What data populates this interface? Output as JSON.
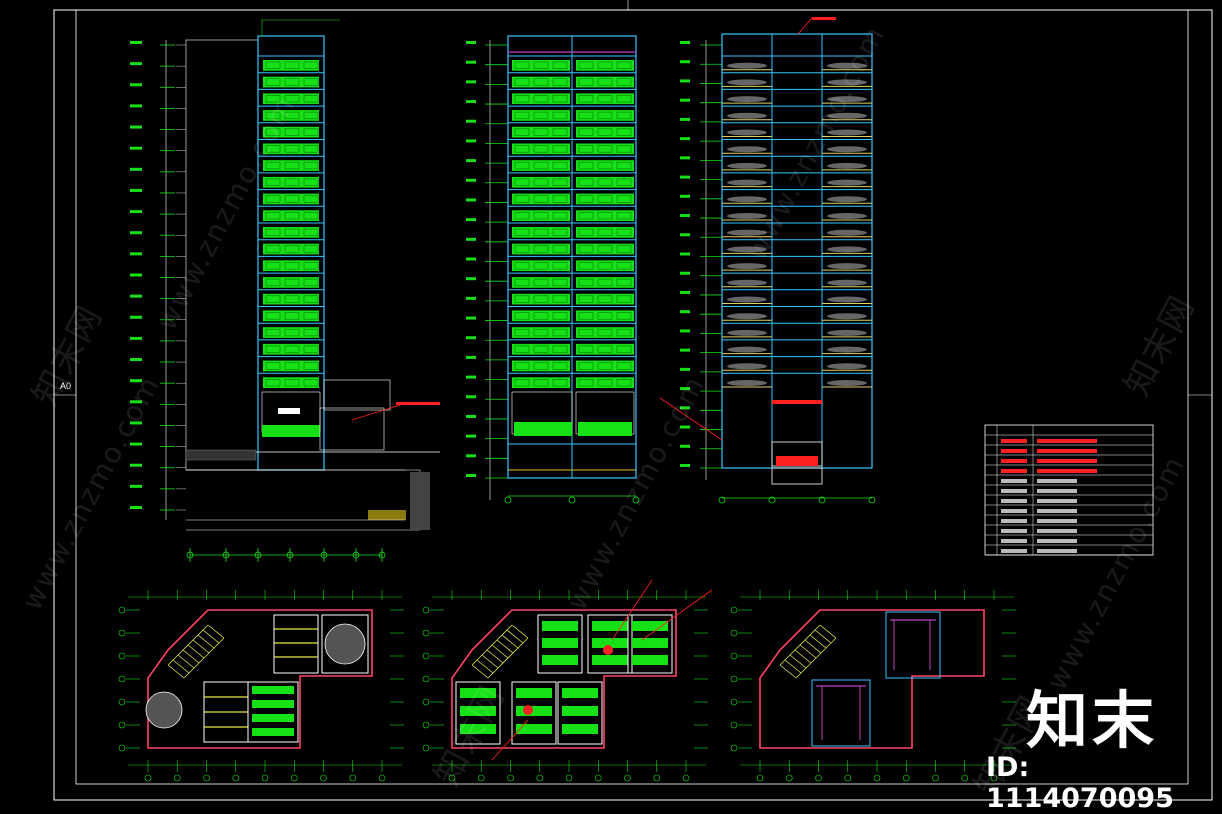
{
  "frame": {
    "label": "A0"
  },
  "watermark": {
    "cn": "知末网",
    "url": "www.znzmo.com"
  },
  "logo": {
    "text": "知末"
  },
  "id_tag": {
    "text": "ID: 1114070095"
  },
  "colors": {
    "background": "#000000",
    "border": "#ffffff",
    "structure": "#35c6ff",
    "parking": "#16e016",
    "annotation": "#ff2020",
    "grid_line": "#e8e800",
    "wall": "#ff4466",
    "stair": "#e6e64a"
  },
  "drawings": {
    "elevation_a": {
      "floors": 20,
      "icon": "elevation-drawing"
    },
    "elevation_b": {
      "floors": 20,
      "icon": "elevation-drawing"
    },
    "section": {
      "floors": 20,
      "icon": "section-drawing"
    },
    "plans": [
      {
        "icon": "floor-plan-1"
      },
      {
        "icon": "floor-plan-2"
      },
      {
        "icon": "floor-plan-3"
      }
    ]
  },
  "legend_table": {
    "rows": 12,
    "icon": "legend-table"
  }
}
